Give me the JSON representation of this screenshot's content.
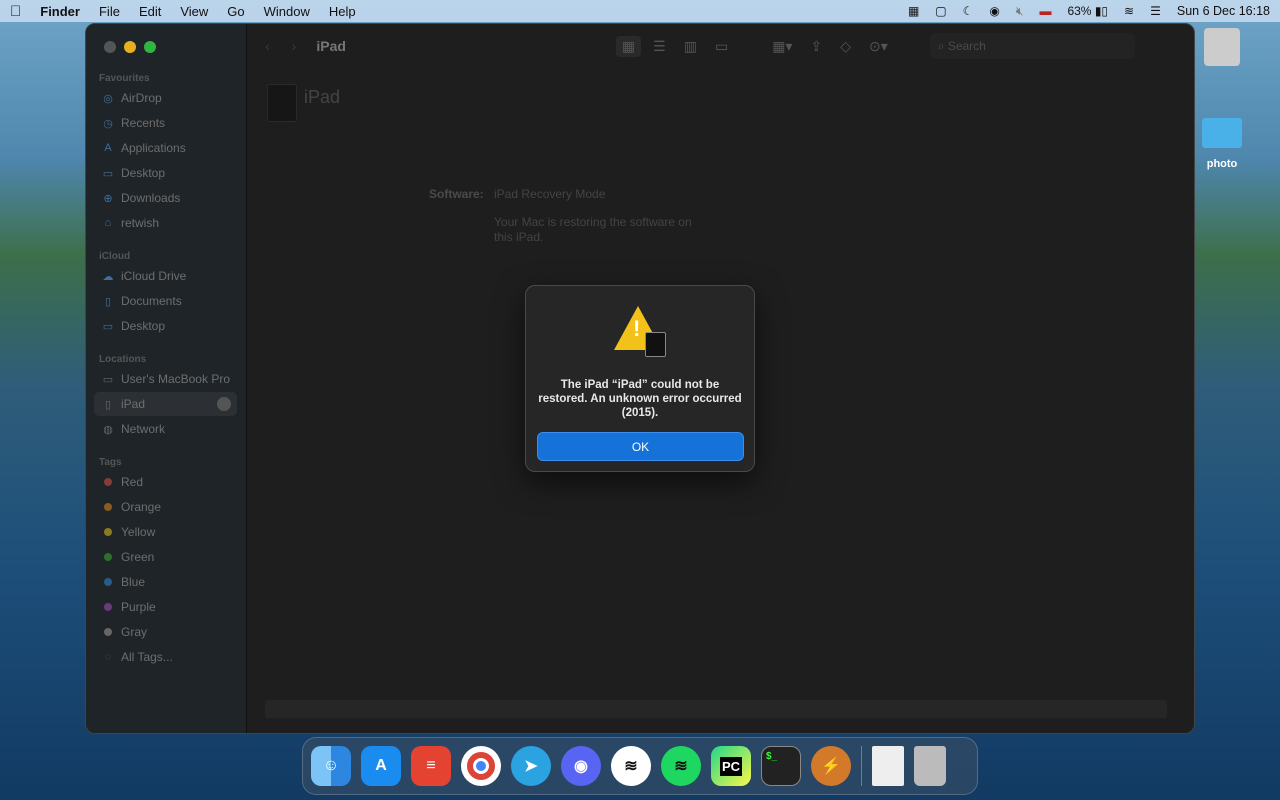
{
  "menubar": {
    "apple": "",
    "app": "Finder",
    "items": [
      "File",
      "Edit",
      "View",
      "Go",
      "Window",
      "Help"
    ],
    "battery": "63%",
    "datetime": "Sun 6 Dec  16:18"
  },
  "sidebar": {
    "favourites_label": "Favourites",
    "favourites": [
      {
        "icon": "airdrop-icon",
        "label": "AirDrop"
      },
      {
        "icon": "clock-icon",
        "label": "Recents"
      },
      {
        "icon": "applications-icon",
        "label": "Applications"
      },
      {
        "icon": "desktop-icon",
        "label": "Desktop"
      },
      {
        "icon": "download-icon",
        "label": "Downloads"
      },
      {
        "icon": "home-icon",
        "label": "retwish"
      }
    ],
    "icloud_label": "iCloud",
    "icloud": [
      {
        "icon": "cloud-icon",
        "label": "iCloud Drive"
      },
      {
        "icon": "document-icon",
        "label": "Documents"
      },
      {
        "icon": "desktop-icon",
        "label": "Desktop"
      }
    ],
    "locations_label": "Locations",
    "locations": [
      {
        "icon": "laptop-icon",
        "label": "User's MacBook Pro"
      },
      {
        "icon": "ipad-icon",
        "label": "iPad"
      },
      {
        "icon": "globe-icon",
        "label": "Network"
      }
    ],
    "tags_label": "Tags",
    "tags": [
      {
        "label": "Red",
        "color": "#8a3a38"
      },
      {
        "label": "Orange",
        "color": "#8a5a20"
      },
      {
        "label": "Yellow",
        "color": "#8a7a20"
      },
      {
        "label": "Green",
        "color": "#2e6e2e"
      },
      {
        "label": "Blue",
        "color": "#2a5a88"
      },
      {
        "label": "Purple",
        "color": "#6a3a7a"
      },
      {
        "label": "Gray",
        "color": "#666666"
      },
      {
        "label": "All Tags...",
        "color": ""
      }
    ]
  },
  "toolbar": {
    "title": "iPad",
    "search_placeholder": "Search"
  },
  "main": {
    "device_name": "iPad",
    "software_label": "Software:",
    "software_value": "iPad Recovery Mode",
    "status": "Your Mac is restoring the software on this iPad."
  },
  "dialog": {
    "message": "The iPad “iPad” could not be restored. An unknown error occurred (2015).",
    "ok": "OK"
  },
  "desktop": {
    "folder": "photo"
  },
  "dock": [
    "Finder",
    "App Store",
    "Todoist",
    "Chrome",
    "Telegram",
    "Discord",
    "App",
    "Spotify",
    "PyCharm",
    "Terminal",
    "Reeder",
    "Document",
    "Trash"
  ]
}
